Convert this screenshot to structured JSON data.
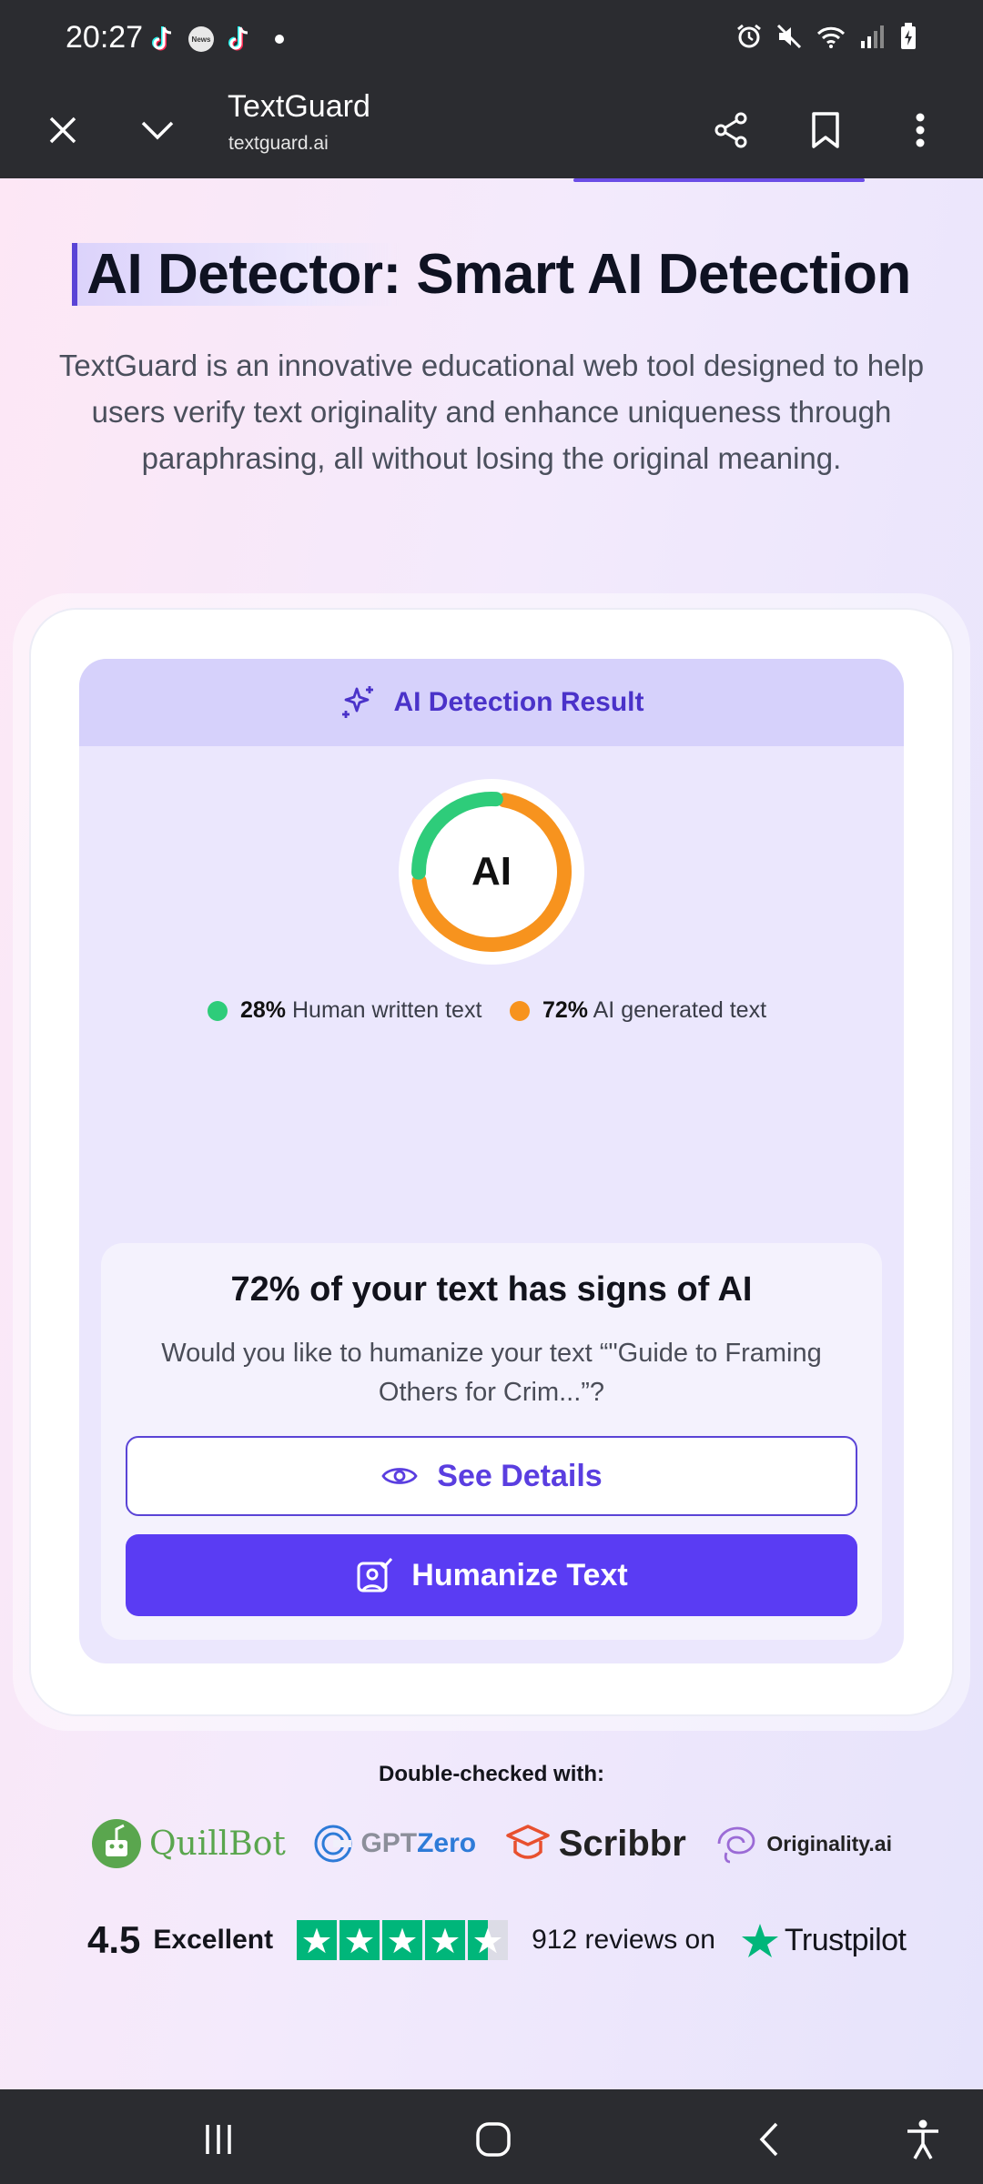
{
  "status_bar": {
    "time": "20:27",
    "notifications": [
      "tiktok-icon",
      "news-icon",
      "tiktok-icon",
      "dot"
    ],
    "news_label": "News",
    "system_icons": [
      "alarm-icon",
      "mute-icon",
      "wifi-icon",
      "signal-icon",
      "battery-icon"
    ]
  },
  "browser": {
    "title": "TextGuard",
    "url": "textguard.ai",
    "icons": [
      "close-icon",
      "chevron-down-icon",
      "share-icon",
      "bookmark-icon",
      "more-vert-icon"
    ]
  },
  "hero": {
    "title_highlight": "AI Detector:",
    "title_rest": " Smart AI Detection",
    "description": "TextGuard is an innovative educational web tool designed to help users verify text originality and enhance uniqueness through paraphrasing, all without losing the original meaning."
  },
  "result": {
    "header": "AI Detection Result",
    "donut_label": "AI",
    "human_percent": "28%",
    "human_label": "Human written text",
    "ai_percent": "72%",
    "ai_label": "AI generated text",
    "human_fraction": 0.28,
    "ai_fraction": 0.72,
    "human_color": "#2ecc7a",
    "ai_color": "#f7931e"
  },
  "message": {
    "title": "72% of your text has signs of AI",
    "body": "Would you like to humanize your text “\"Guide to Framing Others for Crim...”?",
    "see_details": "See Details",
    "humanize": "Humanize Text"
  },
  "partners": {
    "label": "Double-checked with:",
    "quillbot": "QuillBot",
    "gptzero_a": "GPT",
    "gptzero_b": "Zero",
    "scribbr": "Scribbr",
    "originality": "Originality.ai"
  },
  "rating": {
    "score": "4.5",
    "word": "Excellent",
    "stars": 4.5,
    "reviews": "912 reviews on",
    "brand": "Trustpilot"
  },
  "colors": {
    "accent": "#5a3cf3",
    "trustpilot": "#00b67a"
  }
}
